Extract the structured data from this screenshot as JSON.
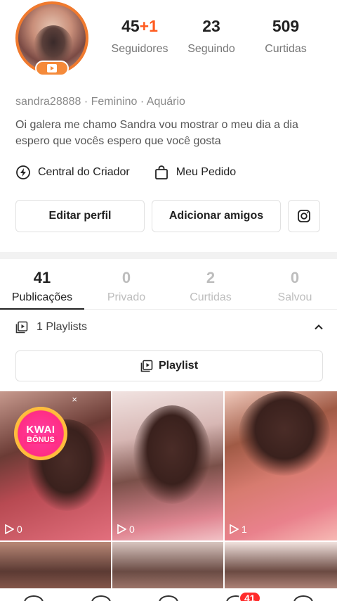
{
  "profile": {
    "stats": [
      {
        "value": "45",
        "plus": "+1",
        "label": "Seguidores"
      },
      {
        "value": "23",
        "plus": "",
        "label": "Seguindo"
      },
      {
        "value": "509",
        "plus": "",
        "label": "Curtidas"
      }
    ],
    "meta": "sandra28888 · Feminino · Aquário",
    "bio": "Oi galera me chamo Sandra vou mostrar o meu dia a dia espero que vocês espero que você gosta"
  },
  "links": {
    "creator_center": "Central do Criador",
    "my_order": "Meu Pedido"
  },
  "buttons": {
    "edit_profile": "Editar perfil",
    "add_friends": "Adicionar amigos"
  },
  "tabs": [
    {
      "count": "41",
      "label": "Publicações"
    },
    {
      "count": "0",
      "label": "Privado"
    },
    {
      "count": "2",
      "label": "Curtidas"
    },
    {
      "count": "0",
      "label": "Salvou"
    }
  ],
  "playlists": {
    "summary": "1 Playlists",
    "button_label": "Playlist"
  },
  "grid": {
    "items": [
      {
        "plays": "0",
        "badge": {
          "line1": "KWAI",
          "line2": "BÔNUS",
          "close": "×"
        }
      },
      {
        "plays": "0"
      },
      {
        "plays": "1"
      }
    ]
  },
  "nav": {
    "notification_count": "41"
  },
  "icons": {
    "creator": "lightning-circle-icon",
    "order": "bag-icon",
    "instagram": "instagram-icon",
    "playlist": "playlist-icon",
    "collapse": "chevron-up-icon",
    "play": "play-icon"
  },
  "colors": {
    "accent": "#ff5b1f",
    "avatar_ring": "#f07a2e",
    "notification": "#ff2b2b"
  }
}
